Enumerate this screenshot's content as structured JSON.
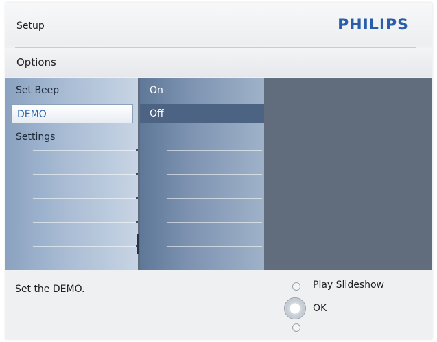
{
  "header": {
    "title": "Setup",
    "brand": "PHILIPS"
  },
  "breadcrumb": "Options",
  "menu": {
    "items": [
      {
        "label": "Set Beep",
        "selected": false
      },
      {
        "label": "DEMO",
        "selected": true
      },
      {
        "label": "Settings",
        "selected": false
      }
    ]
  },
  "submenu": {
    "items": [
      {
        "label": "On",
        "active": false
      },
      {
        "label": "Off",
        "active": true
      }
    ]
  },
  "footer": {
    "help_text": "Set the DEMO.",
    "actions": [
      {
        "label": "Play Slideshow",
        "icon": "radio-small-icon"
      },
      {
        "label": "OK",
        "icon": "ok-dial-icon"
      }
    ]
  },
  "colors": {
    "brand": "#2a5ea8",
    "selected_text": "#2e66b5",
    "panel_bg": "#616c7c"
  }
}
